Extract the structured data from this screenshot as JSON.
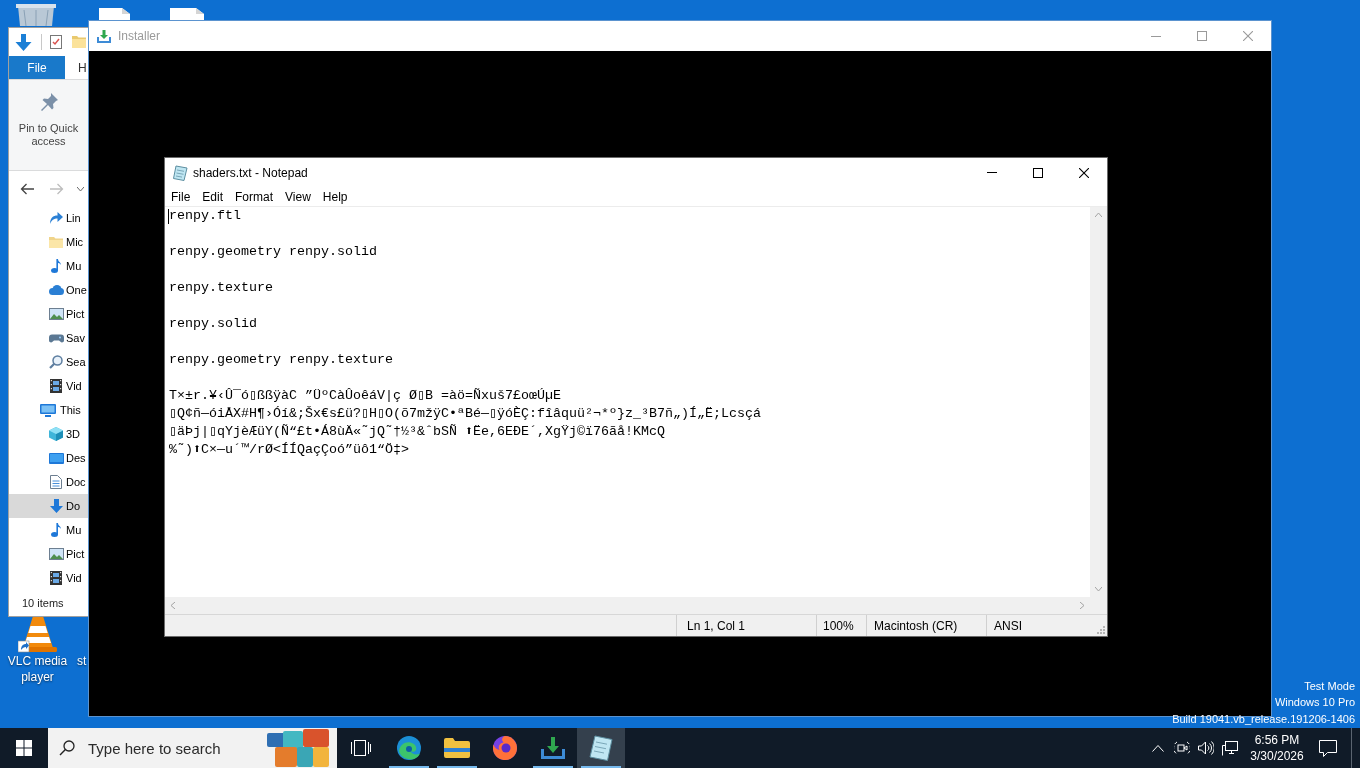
{
  "desktop": {
    "icons": [
      {
        "label": "VLC media player",
        "kind": "cone"
      },
      {
        "label": "st",
        "kind": "covered"
      }
    ],
    "test_mode_notice": [
      "Test Mode",
      "Windows 10 Pro",
      "Build 19041.vb_release.191206-1406"
    ]
  },
  "explorer_window": {
    "ribbon_tabs": [
      {
        "label": "File",
        "kind": "file"
      },
      {
        "label": "H",
        "kind": "tab"
      }
    ],
    "ribbon_button": "Pin to Quick access",
    "nav_tree": [
      {
        "children": [
          {
            "label": "Lin",
            "kind": "link",
            "selected": false
          },
          {
            "label": "Mic",
            "kind": "folder",
            "selected": false
          },
          {
            "label": "Mu",
            "kind": "music",
            "selected": false
          },
          {
            "label": "One",
            "kind": "cloud",
            "selected": false
          },
          {
            "label": "Pict",
            "kind": "pictures",
            "selected": false
          },
          {
            "label": "Sav",
            "kind": "games",
            "selected": false
          },
          {
            "label": "Sea",
            "kind": "search",
            "selected": false
          },
          {
            "label": "Vid",
            "kind": "videos",
            "selected": false
          }
        ]
      },
      {
        "label": "This",
        "kind": "pc",
        "selected": false,
        "children": [
          {
            "label": "3D",
            "kind": "cube",
            "selected": false
          },
          {
            "label": "Des",
            "kind": "desktop",
            "selected": false
          },
          {
            "label": "Doc",
            "kind": "documents",
            "selected": false
          },
          {
            "label": "Do",
            "kind": "downloads",
            "selected": true
          },
          {
            "label": "Mu",
            "kind": "music",
            "selected": false
          },
          {
            "label": "Pict",
            "kind": "pictures",
            "selected": false
          },
          {
            "label": "Vid",
            "kind": "videos",
            "selected": false
          }
        ]
      }
    ],
    "status": "10 items"
  },
  "installer_window": {
    "title": "Installer",
    "active": false
  },
  "notepad_window": {
    "title": "shaders.txt - Notepad",
    "active": true,
    "menu": [
      "File",
      "Edit",
      "Format",
      "View",
      "Help"
    ],
    "text_blocks": [
      [
        "renpy.ftl"
      ],
      [
        "renpy.geometry renpy.solid"
      ],
      [
        "renpy.texture"
      ],
      [
        "renpy.solid"
      ],
      [
        "renpy.geometry renpy.texture"
      ],
      [
        "T×±r.¥‹Û¯ó▯ßßÿàC ”ÜºCàÛoêáV|ç Ø▯B =àö=Ñxuš7£oœÚµE",
        "▯Q¢ñ—óiÅX#H¶›Óí&;Šx€s£ü?▯H▯O(õ7mžÿC•ªBé—▯ÿóÈÇ:fîâquü²¬*º}z_³B7ñ„)Í„Ë;Lcsçá",
        "▯äÞj|▯qYjèÆüY(Ñ“£t•Á8ùÄ«˜jQ˜†½³&ˆbSÑ ⬆Ëe,6EÐE´,XgŸj©ï76ãå!KMcQ",
        "%˜)⬆C×—u´™/rØ<ÍÍQaçÇoó”üô1“Ö‡>"
      ]
    ],
    "status_bar": {
      "position": "Ln 1, Col 1",
      "zoom": "100%",
      "line_ending": "Macintosh (CR)",
      "encoding": "ANSI"
    }
  },
  "taskbar": {
    "search": {
      "placeholder": "Type here to search"
    },
    "apps": [
      {
        "kind": "edge",
        "running": true,
        "selected": false
      },
      {
        "kind": "folder",
        "running": true,
        "selected": false
      },
      {
        "kind": "firefox",
        "running": false,
        "selected": false
      },
      {
        "kind": "download",
        "running": true,
        "selected": false
      },
      {
        "kind": "notepad",
        "running": true,
        "selected": true
      }
    ],
    "clock": {
      "time": "6:56 PM",
      "date": "3/30/2026"
    }
  }
}
